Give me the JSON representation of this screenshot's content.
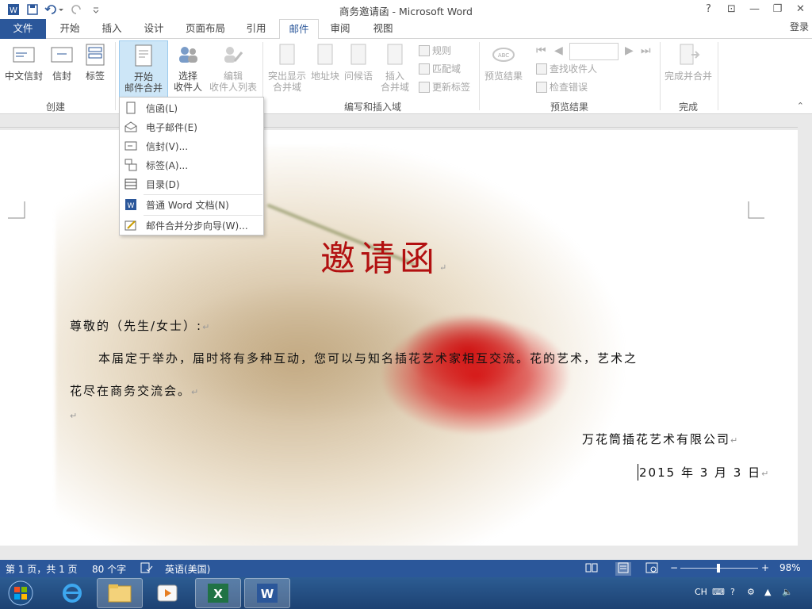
{
  "app": {
    "title": "商务邀请函 - Microsoft Word",
    "signin": "登录"
  },
  "window_controls": {
    "help": "?",
    "restore_ribbon": "⊡",
    "minimize": "—",
    "restore": "❐",
    "close": "✕"
  },
  "qat": {
    "word_icon": "word-logo-icon",
    "save": "save-icon",
    "undo": "undo-icon",
    "redo": "redo-icon",
    "customize": "customize-icon"
  },
  "tabs": [
    {
      "label": "文件"
    },
    {
      "label": "开始"
    },
    {
      "label": "插入"
    },
    {
      "label": "设计"
    },
    {
      "label": "页面布局"
    },
    {
      "label": "引用"
    },
    {
      "label": "邮件"
    },
    {
      "label": "审阅"
    },
    {
      "label": "视图"
    }
  ],
  "ribbon": {
    "groups": {
      "create": "创建",
      "write_insert": "编写和插入域",
      "preview": "预览结果",
      "finish": "完成"
    },
    "buttons": {
      "chinese_envelope": "中文信封",
      "envelope": "信封",
      "labels": "标签",
      "start_merge_1": "开始",
      "start_merge_2": "邮件合并",
      "select_recipients_1": "选择",
      "select_recipients_2": "收件人",
      "edit_list_1": "编辑",
      "edit_list_2": "收件人列表",
      "highlight_1": "突出显示",
      "highlight_2": "合并域",
      "address_block": "地址块",
      "greeting": "问候语",
      "insert_field_1": "插入",
      "insert_field_2": "合并域",
      "rules": "规则",
      "match_fields": "匹配域",
      "update_labels": "更新标签",
      "preview_results": "预览结果",
      "find_recipient": "查找收件人",
      "check_errors": "检查错误",
      "finish_merge": "完成并合并"
    }
  },
  "dropdown": {
    "items": [
      {
        "label": "信函(L)"
      },
      {
        "label": "电子邮件(E)"
      },
      {
        "label": "信封(V)..."
      },
      {
        "label": "标签(A)..."
      },
      {
        "label": "目录(D)"
      },
      {
        "label": "普通 Word 文档(N)"
      },
      {
        "label": "邮件合并分步向导(W)..."
      }
    ]
  },
  "document": {
    "heading": "邀请函",
    "greeting": "尊敬的（先生/女士）:",
    "body_line1": "本届定于举办，届时将有多种互动，您可以与知名插花艺术家相互交流。花的艺术，艺术之",
    "body_line2": "花尽在商务交流会。",
    "company": "万花筒插花艺术有限公司",
    "date": "2015 年 3 月 3 日",
    "para_mark": "↵"
  },
  "status": {
    "page": "第 1 页，共 1 页",
    "words": "80 个字",
    "language": "英语(美国)",
    "zoom": "98%",
    "zoom_level": 0.49
  },
  "taskbar": {
    "ime": "CH"
  }
}
